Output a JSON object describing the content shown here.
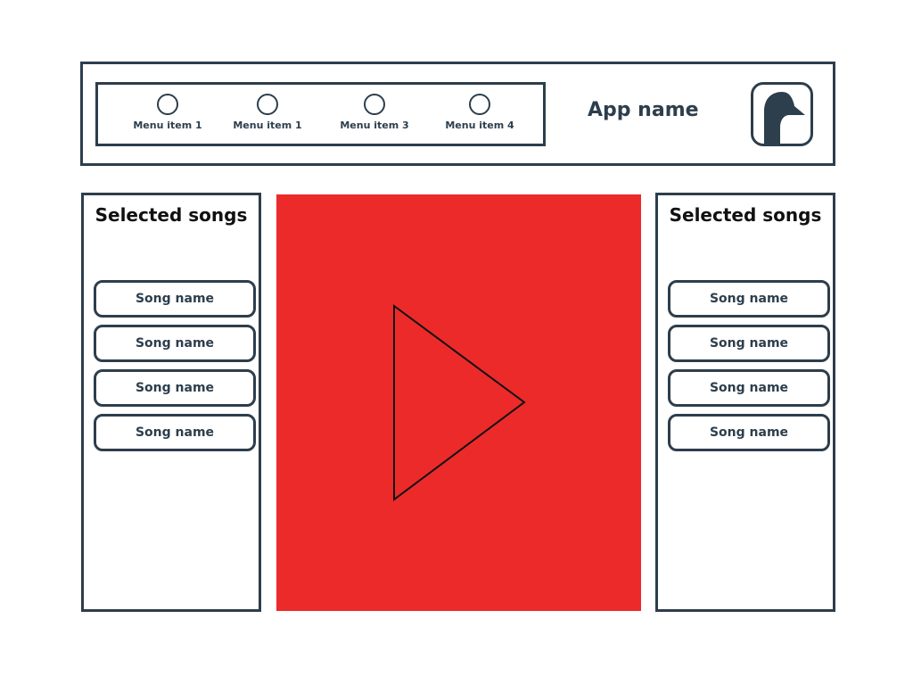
{
  "header": {
    "menu": [
      {
        "label": "Menu item 1",
        "icon": "circle-icon"
      },
      {
        "label": "Menu item 1",
        "icon": "circle-icon"
      },
      {
        "label": "Menu item 3",
        "icon": "circle-icon"
      },
      {
        "label": "Menu item 4",
        "icon": "circle-icon"
      }
    ],
    "app_name": "App name",
    "logo_icon": "bird-logo-icon"
  },
  "left_panel": {
    "title": "Selected songs",
    "songs": [
      "Song name",
      "Song name",
      "Song name",
      "Song name"
    ]
  },
  "right_panel": {
    "title": "Selected songs",
    "songs": [
      "Song name",
      "Song name",
      "Song name",
      "Song name"
    ]
  },
  "player": {
    "icon": "play-icon",
    "background_color": "#ec2a2a"
  },
  "colors": {
    "outline": "#2d3e4c",
    "player": "#ec2a2a"
  }
}
